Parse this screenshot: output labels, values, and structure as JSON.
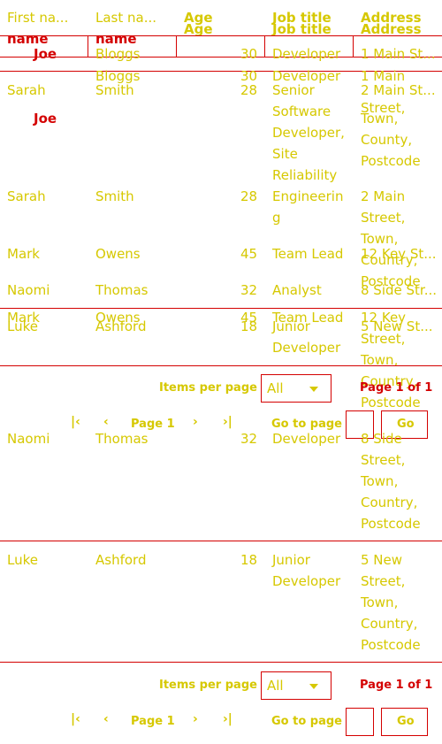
{
  "header": {
    "first_name": "First na...",
    "last_name": "Last na...",
    "age": "Age",
    "job_title": "Job title",
    "address": "Address",
    "age_ghost": "Age",
    "job_ghost": "Job title",
    "address_ghost": "Address",
    "name_left": "name",
    "name_right": "name"
  },
  "rows_top": [
    {
      "first": "Joe",
      "last": "Bloggs",
      "age": "30",
      "job": "Developer",
      "address": "1 Main St..."
    },
    {
      "first": "",
      "last": "Bloggs",
      "age": "30",
      "job": "Developer",
      "address": "1 Main"
    }
  ],
  "rows": [
    {
      "first": "Sarah",
      "last": "Smith",
      "age": "28",
      "job": "Senior",
      "address": "2 Main St..."
    },
    {
      "first": "Joe",
      "last": "",
      "age": "",
      "job": "Software",
      "address": "Street,"
    },
    {
      "first": "",
      "last": "",
      "age": "",
      "job": "Developer,",
      "address": "Town,"
    },
    {
      "first": "",
      "last": "",
      "age": "",
      "job": "Site",
      "address": "County,"
    },
    {
      "first": "",
      "last": "",
      "age": "",
      "job": "Reliability",
      "address": "Postcode"
    }
  ],
  "block2": [
    {
      "first": "Sarah",
      "last": "Smith",
      "age": "28",
      "job": "Engineerin",
      "address": "2 Main"
    },
    {
      "job": "g",
      "address": "Street,"
    },
    {
      "address": "Town,"
    }
  ],
  "row_mark": {
    "first": "Mark",
    "last": "Owens",
    "age": "45",
    "job": "Team Lead",
    "address": "12 Key St..."
  },
  "ghost_country": "Country,",
  "ghost_postcode": "Postcode",
  "row_naomi": {
    "first": "Naomi",
    "last": "Thomas",
    "age": "32",
    "job": "Analyst",
    "address": "8 Side Str..."
  },
  "row_mark2": {
    "first": "Mark",
    "last": "Owens",
    "age": "45",
    "job": "Team Lead",
    "address": "12 Key"
  },
  "row_luke": {
    "first": "Luke",
    "last": "Ashford",
    "age": "18",
    "job": "Junior",
    "address": "5 New St..."
  },
  "luke_lines": [
    "Developer",
    "Street,",
    "Town,",
    "Country,",
    "Postcode"
  ],
  "pager1": {
    "items_label": "Items per page",
    "items_value": "All",
    "page_of": "Page 1 of 1",
    "page_label": "Page 1",
    "goto_label": "Go to page",
    "go_button": "Go"
  },
  "row_naomi2": {
    "first": "Naomi",
    "last": "Thomas",
    "age": "32",
    "job": "Developer",
    "address": "8 Side"
  },
  "naomi2_lines": [
    "Street,",
    "Town,",
    "Country,",
    "Postcode"
  ],
  "row_luke2": {
    "first": "Luke",
    "last": "Ashford",
    "age": "18",
    "job": "Junior",
    "address": "5 New"
  },
  "luke2_lines": [
    {
      "job": "Developer",
      "address": "Street,"
    },
    {
      "job": "",
      "address": "Town,"
    },
    {
      "job": "",
      "address": "Country,"
    },
    {
      "job": "",
      "address": "Postcode"
    }
  ],
  "pager2": {
    "items_label": "Items per page",
    "items_value": "All",
    "page_of": "Page 1 of 1",
    "page_label": "Page 1",
    "goto_label": "Go to page",
    "go_button": "Go"
  },
  "icons": {
    "first": "first-page-icon",
    "prev": "previous-page-icon",
    "next": "next-page-icon",
    "last": "last-page-icon",
    "dropdown": "chevron-down-icon"
  },
  "colors": {
    "text": "#d6c800",
    "accent": "#d40000",
    "background": "#ffffff"
  }
}
